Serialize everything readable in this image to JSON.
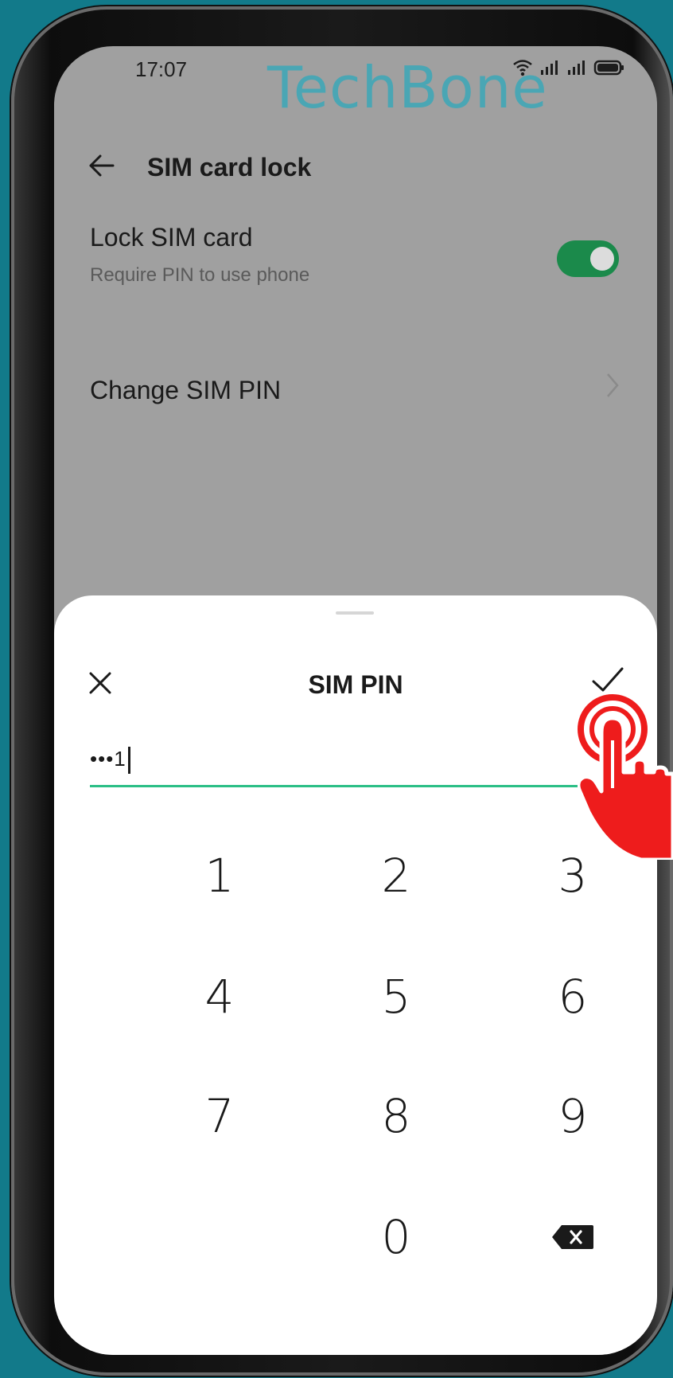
{
  "status_bar": {
    "time": "17:07"
  },
  "watermark": "TechBone",
  "app_bar": {
    "title": "SIM card lock"
  },
  "settings": {
    "lock_sim": {
      "title": "Lock SIM card",
      "subtitle": "Require PIN to use phone",
      "enabled": true
    },
    "change_pin": {
      "title": "Change SIM PIN"
    }
  },
  "dialog": {
    "title": "SIM PIN",
    "pin_display": "•••1",
    "keypad": [
      "1",
      "2",
      "3",
      "4",
      "5",
      "6",
      "7",
      "8",
      "9",
      "0"
    ]
  },
  "colors": {
    "accent": "#1b8a4b",
    "underline": "#2bbf86",
    "background": "#127a8a",
    "hand": "#ee1c1c"
  }
}
